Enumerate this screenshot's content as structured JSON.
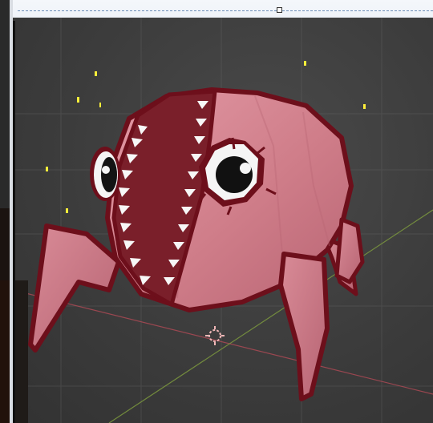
{
  "app": {
    "name": ""
  },
  "scene": {
    "accent_grid_x": "#b34a56",
    "accent_grid_y": "#7d9a3e",
    "background": "#3b3b3b",
    "model_fill": "#d27c88",
    "model_outline": "#6d0f1b",
    "mouth_fill": "#7a1f2a"
  },
  "icons": {
    "origin_marker": "origin-marker-icon",
    "handle": "selection-handle-icon"
  }
}
